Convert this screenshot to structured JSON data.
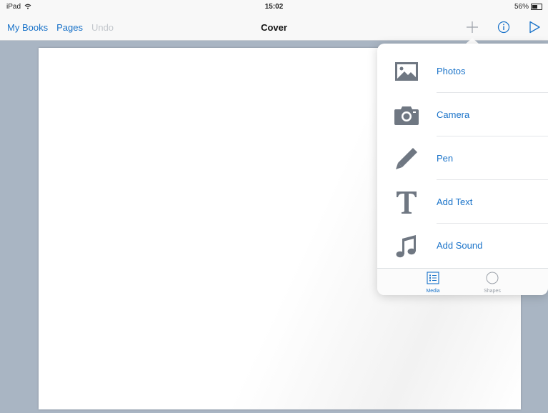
{
  "status_bar": {
    "device": "iPad",
    "time": "15:02",
    "battery": "56%",
    "battery_fraction": 0.56
  },
  "nav": {
    "my_books": "My Books",
    "pages": "Pages",
    "undo": "Undo",
    "title": "Cover",
    "icons": [
      "plus-icon",
      "info-icon",
      "play-icon"
    ]
  },
  "popover": {
    "items": [
      {
        "label": "Photos",
        "icon": "photo-icon"
      },
      {
        "label": "Camera",
        "icon": "camera-icon"
      },
      {
        "label": "Pen",
        "icon": "pen-icon"
      },
      {
        "label": "Add Text",
        "icon": "text-icon"
      },
      {
        "label": "Add Sound",
        "icon": "music-note-icon"
      }
    ],
    "tabs": [
      {
        "label": "Media",
        "icon": "list-icon",
        "selected": true
      },
      {
        "label": "Shapes",
        "icon": "circle-icon",
        "selected": false
      }
    ]
  },
  "colors": {
    "accent": "#1a73c9",
    "icon_gray": "#6f7782",
    "background": "#a9b5c3",
    "disabled": "#c4c8cd"
  }
}
